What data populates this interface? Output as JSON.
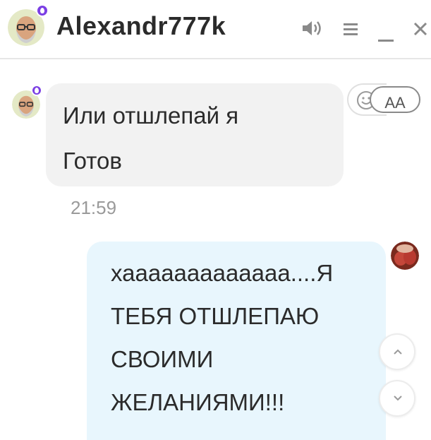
{
  "header": {
    "title": "Alexandr777k",
    "icons": [
      "avatar",
      "status-drop-icon",
      "speaker-icon",
      "menu-icon",
      "minimize-icon",
      "close-icon"
    ]
  },
  "messages": [
    {
      "direction": "incoming",
      "lines": [
        "Или отшлепай я",
        "Готов"
      ],
      "time": "21:59"
    },
    {
      "direction": "outgoing",
      "lines": [
        "хааааааааааааа....Я",
        "ТЕБЯ ОТШЛЕПАЮ",
        "СВОИМИ",
        "ЖЕЛАНИЯМИ!!!"
      ]
    }
  ],
  "tools": {
    "text_size_label": "АА"
  },
  "colors": {
    "incoming_bubble": "#f2f2f2",
    "outgoing_bubble": "#e8f6fd",
    "status_badge": "#7b3fe4",
    "icon_gray": "#8a8a8a"
  }
}
